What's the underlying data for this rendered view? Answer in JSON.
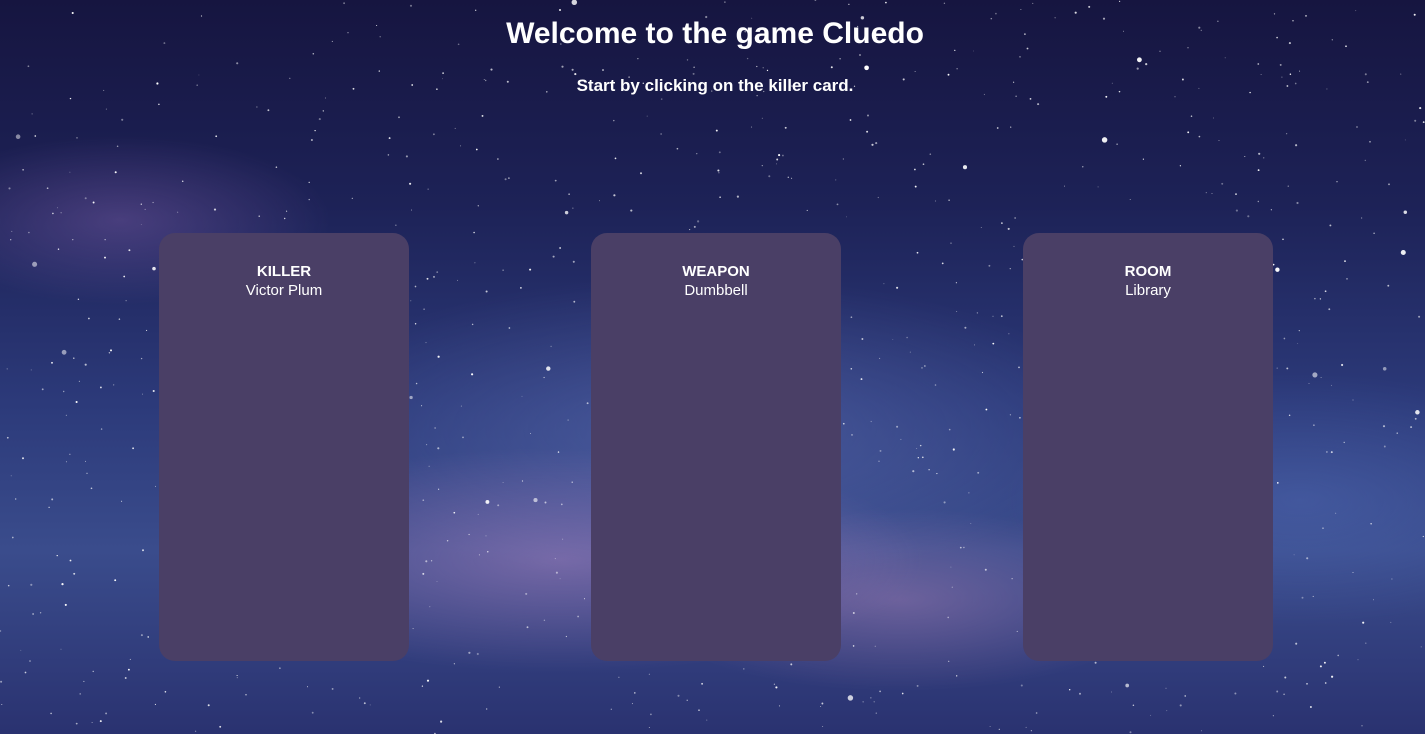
{
  "header": {
    "title": "Welcome to the game Cluedo",
    "subtitle": "Start by clicking on the killer card."
  },
  "cards": [
    {
      "label": "KILLER",
      "value": "Victor Plum"
    },
    {
      "label": "WEAPON",
      "value": "Dumbbell"
    },
    {
      "label": "ROOM",
      "value": "Library"
    }
  ],
  "colors": {
    "card_background": "#4a3f66",
    "text": "#ffffff",
    "sky_dark": "#161540",
    "sky_light": "#3a4c8c"
  }
}
